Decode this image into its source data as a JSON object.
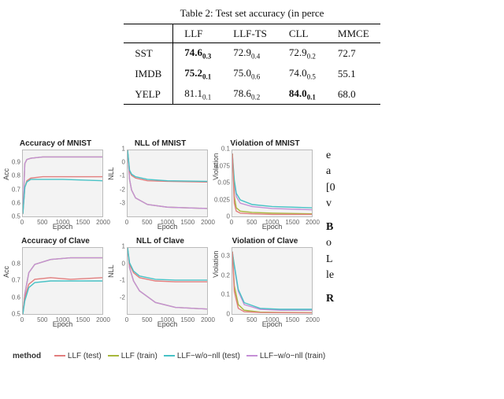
{
  "table": {
    "caption": "Table 2: Test set accuracy (in perce",
    "headers": [
      "",
      "LLF",
      "LLF-TS",
      "CLL",
      "MMCE"
    ],
    "rows": [
      {
        "name": "SST",
        "llf": {
          "v": "74.6",
          "s": "0.3",
          "b": true
        },
        "llfts": {
          "v": "72.9",
          "s": "0.4"
        },
        "cll": {
          "v": "72.9",
          "s": "0.2"
        },
        "mmce": {
          "v": "72.7"
        }
      },
      {
        "name": "IMDB",
        "llf": {
          "v": "75.2",
          "s": "0.1",
          "b": true
        },
        "llfts": {
          "v": "75.0",
          "s": "0.6"
        },
        "cll": {
          "v": "74.0",
          "s": "0.5"
        },
        "mmce": {
          "v": "55.1"
        }
      },
      {
        "name": "YELP",
        "llf": {
          "v": "81.1",
          "s": "0.1"
        },
        "llfts": {
          "v": "78.6",
          "s": "0.2"
        },
        "cll": {
          "v": "84.0",
          "s": "0.1",
          "b": true
        },
        "mmce": {
          "v": "68.0"
        }
      }
    ]
  },
  "legend": {
    "label": "method",
    "items": [
      {
        "name": "LLF (test)",
        "color": "#e27e7e"
      },
      {
        "name": "LLF (train)",
        "color": "#a7b83b"
      },
      {
        "name": "LLF−w/o−nll (test)",
        "color": "#47c2c6"
      },
      {
        "name": "LLF−w/o−nll (train)",
        "color": "#c58fd6"
      }
    ]
  },
  "right_text": {
    "p1a": "e",
    "p1b": "a",
    "p1c": "[0",
    "p1d": "v",
    "p2a": "B",
    "p2b": "o",
    "p2c": "L",
    "p2d": "le",
    "p3": "R"
  },
  "chart_data": [
    {
      "id": "acc-mnist",
      "type": "line",
      "title": "Accuracy of MNIST",
      "xlabel": "Epoch",
      "ylabel": "Acc",
      "xlim": [
        0,
        2000
      ],
      "ylim": [
        0.5,
        1.0
      ],
      "yticks": [
        0.5,
        0.6,
        0.7,
        0.8,
        0.9
      ],
      "xticks": [
        0,
        500,
        1000,
        1500,
        2000
      ],
      "series": [
        {
          "name": "LLF (train)",
          "color": "#a7b83b",
          "x": [
            0,
            50,
            100,
            200,
            500,
            1000,
            2000
          ],
          "y": [
            0.52,
            0.9,
            0.93,
            0.94,
            0.95,
            0.95,
            0.95
          ]
        },
        {
          "name": "LLF−w/o−nll (train)",
          "color": "#c58fd6",
          "x": [
            0,
            50,
            100,
            200,
            500,
            1000,
            2000
          ],
          "y": [
            0.52,
            0.9,
            0.93,
            0.94,
            0.95,
            0.95,
            0.95
          ]
        },
        {
          "name": "LLF (test)",
          "color": "#e27e7e",
          "x": [
            0,
            50,
            100,
            200,
            500,
            1000,
            2000
          ],
          "y": [
            0.52,
            0.72,
            0.77,
            0.79,
            0.8,
            0.8,
            0.8
          ]
        },
        {
          "name": "LLF−w/o−nll (test)",
          "color": "#47c2c6",
          "x": [
            0,
            50,
            100,
            200,
            500,
            1000,
            2000
          ],
          "y": [
            0.52,
            0.72,
            0.76,
            0.78,
            0.78,
            0.78,
            0.77
          ]
        }
      ]
    },
    {
      "id": "nll-mnist",
      "type": "line",
      "title": "NLL of MNIST",
      "xlabel": "Epoch",
      "ylabel": "NLL",
      "xlim": [
        0,
        2000
      ],
      "ylim": [
        -4,
        1
      ],
      "yticks": [
        -3,
        -2,
        -1,
        0,
        1
      ],
      "xticks": [
        0,
        500,
        1000,
        1500,
        2000
      ],
      "series": [
        {
          "name": "LLF (train)",
          "color": "#a7b83b",
          "x": [
            0,
            50,
            100,
            200,
            500,
            1000,
            2000
          ],
          "y": [
            1.0,
            -1.2,
            -2.0,
            -2.6,
            -3.1,
            -3.3,
            -3.4
          ]
        },
        {
          "name": "LLF−w/o−nll (train)",
          "color": "#c58fd6",
          "x": [
            0,
            50,
            100,
            200,
            500,
            1000,
            2000
          ],
          "y": [
            1.0,
            -1.2,
            -2.0,
            -2.6,
            -3.1,
            -3.3,
            -3.4
          ]
        },
        {
          "name": "LLF (test)",
          "color": "#e27e7e",
          "x": [
            0,
            50,
            100,
            200,
            500,
            1000,
            2000
          ],
          "y": [
            1.0,
            -0.6,
            -0.9,
            -1.1,
            -1.3,
            -1.35,
            -1.4
          ]
        },
        {
          "name": "LLF−w/o−nll (test)",
          "color": "#47c2c6",
          "x": [
            0,
            50,
            100,
            200,
            500,
            1000,
            2000
          ],
          "y": [
            1.0,
            -0.5,
            -0.8,
            -1.0,
            -1.2,
            -1.3,
            -1.35
          ]
        }
      ]
    },
    {
      "id": "vio-mnist",
      "type": "line",
      "title": "Violation of MNIST",
      "xlabel": "Epoch",
      "ylabel": "Violation",
      "xlim": [
        0,
        2000
      ],
      "ylim": [
        0,
        0.1
      ],
      "yticks": [
        0,
        0.025,
        0.05,
        0.075,
        0.1
      ],
      "xticks": [
        0,
        500,
        1000,
        1500,
        2000
      ],
      "series": [
        {
          "name": "LLF−w/o−nll (train)",
          "color": "#c58fd6",
          "x": [
            0,
            50,
            100,
            200,
            500,
            1000,
            2000
          ],
          "y": [
            0.095,
            0.05,
            0.03,
            0.02,
            0.015,
            0.012,
            0.01
          ]
        },
        {
          "name": "LLF−w/o−nll (test)",
          "color": "#47c2c6",
          "x": [
            0,
            50,
            100,
            200,
            500,
            1000,
            2000
          ],
          "y": [
            0.095,
            0.055,
            0.035,
            0.025,
            0.018,
            0.015,
            0.013
          ]
        },
        {
          "name": "LLF (train)",
          "color": "#a7b83b",
          "x": [
            0,
            50,
            100,
            200,
            500,
            1000,
            2000
          ],
          "y": [
            0.095,
            0.03,
            0.013,
            0.008,
            0.006,
            0.005,
            0.004
          ]
        },
        {
          "name": "LLF (test)",
          "color": "#e27e7e",
          "x": [
            0,
            50,
            100,
            200,
            500,
            1000,
            2000
          ],
          "y": [
            0.095,
            0.02,
            0.008,
            0.005,
            0.004,
            0.003,
            0.003
          ]
        }
      ]
    },
    {
      "id": "acc-clave",
      "type": "line",
      "title": "Accuracy of Clave",
      "xlabel": "Epoch",
      "ylabel": "Acc",
      "xlim": [
        0,
        2000
      ],
      "ylim": [
        0.5,
        0.9
      ],
      "yticks": [
        0.5,
        0.6,
        0.7,
        0.8
      ],
      "xticks": [
        0,
        500,
        1000,
        1500,
        2000
      ],
      "series": [
        {
          "name": "LLF (train)",
          "color": "#a7b83b",
          "x": [
            0,
            50,
            150,
            300,
            700,
            1200,
            2000
          ],
          "y": [
            0.5,
            0.62,
            0.75,
            0.8,
            0.83,
            0.84,
            0.84
          ]
        },
        {
          "name": "LLF−w/o−nll (train)",
          "color": "#c58fd6",
          "x": [
            0,
            50,
            150,
            300,
            700,
            1200,
            2000
          ],
          "y": [
            0.5,
            0.62,
            0.75,
            0.8,
            0.83,
            0.84,
            0.84
          ]
        },
        {
          "name": "LLF (test)",
          "color": "#e27e7e",
          "x": [
            0,
            50,
            150,
            300,
            700,
            1200,
            2000
          ],
          "y": [
            0.5,
            0.6,
            0.68,
            0.71,
            0.72,
            0.71,
            0.72
          ]
        },
        {
          "name": "LLF−w/o−nll (test)",
          "color": "#47c2c6",
          "x": [
            0,
            50,
            150,
            300,
            700,
            1200,
            2000
          ],
          "y": [
            0.5,
            0.58,
            0.66,
            0.69,
            0.7,
            0.7,
            0.7
          ]
        }
      ]
    },
    {
      "id": "nll-clave",
      "type": "line",
      "title": "NLL of Clave",
      "xlabel": "Epoch",
      "ylabel": "NLL",
      "xlim": [
        0,
        2000
      ],
      "ylim": [
        -3,
        1
      ],
      "yticks": [
        -2,
        -1,
        0,
        1
      ],
      "xticks": [
        0,
        500,
        1000,
        1500,
        2000
      ],
      "series": [
        {
          "name": "LLF (train)",
          "color": "#a7b83b",
          "x": [
            0,
            50,
            150,
            300,
            700,
            1200,
            2000
          ],
          "y": [
            1.0,
            -0.2,
            -1.0,
            -1.6,
            -2.3,
            -2.6,
            -2.7
          ]
        },
        {
          "name": "LLF−w/o−nll (train)",
          "color": "#c58fd6",
          "x": [
            0,
            50,
            150,
            300,
            700,
            1200,
            2000
          ],
          "y": [
            1.0,
            -0.2,
            -1.0,
            -1.6,
            -2.3,
            -2.6,
            -2.7
          ]
        },
        {
          "name": "LLF (test)",
          "color": "#e27e7e",
          "x": [
            0,
            50,
            150,
            300,
            700,
            1200,
            2000
          ],
          "y": [
            1.0,
            0.0,
            -0.5,
            -0.8,
            -1.0,
            -1.05,
            -1.05
          ]
        },
        {
          "name": "LLF−w/o−nll (test)",
          "color": "#47c2c6",
          "x": [
            0,
            50,
            150,
            300,
            700,
            1200,
            2000
          ],
          "y": [
            1.0,
            0.1,
            -0.4,
            -0.7,
            -0.9,
            -0.95,
            -0.95
          ]
        }
      ]
    },
    {
      "id": "vio-clave",
      "type": "line",
      "title": "Violation of Clave",
      "xlabel": "Epoch",
      "ylabel": "Violation",
      "xlim": [
        0,
        2000
      ],
      "ylim": [
        0,
        0.35
      ],
      "yticks": [
        0,
        0.1,
        0.2,
        0.3
      ],
      "xticks": [
        0,
        500,
        1000,
        1500,
        2000
      ],
      "series": [
        {
          "name": "LLF−w/o−nll (train)",
          "color": "#c58fd6",
          "x": [
            0,
            50,
            150,
            300,
            700,
            1200,
            2000
          ],
          "y": [
            0.33,
            0.25,
            0.12,
            0.05,
            0.025,
            0.02,
            0.02
          ]
        },
        {
          "name": "LLF−w/o−nll (test)",
          "color": "#47c2c6",
          "x": [
            0,
            50,
            150,
            300,
            700,
            1200,
            2000
          ],
          "y": [
            0.33,
            0.26,
            0.13,
            0.06,
            0.03,
            0.025,
            0.025
          ]
        },
        {
          "name": "LLF (train)",
          "color": "#a7b83b",
          "x": [
            0,
            50,
            150,
            300,
            700,
            1200,
            2000
          ],
          "y": [
            0.33,
            0.15,
            0.05,
            0.02,
            0.01,
            0.008,
            0.007
          ]
        },
        {
          "name": "LLF (test)",
          "color": "#e27e7e",
          "x": [
            0,
            50,
            150,
            300,
            700,
            1200,
            2000
          ],
          "y": [
            0.33,
            0.12,
            0.03,
            0.012,
            0.008,
            0.007,
            0.006
          ]
        }
      ]
    }
  ],
  "chart_layout": {
    "w": 133,
    "h": 118,
    "cols": [
      0,
      133,
      266
    ],
    "rows": [
      0,
      124
    ]
  }
}
